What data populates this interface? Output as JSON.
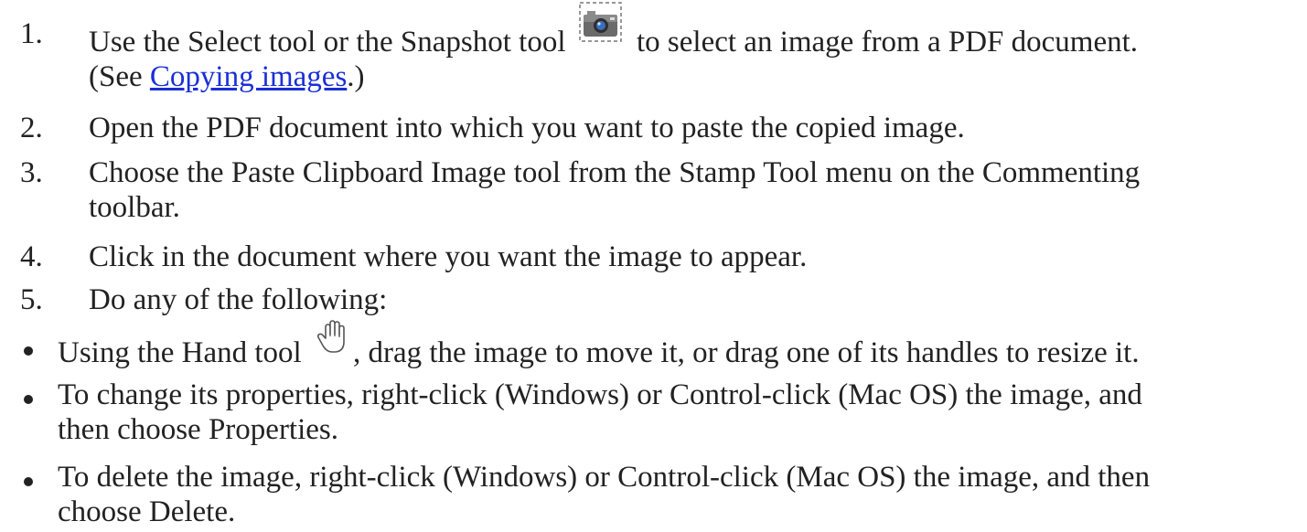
{
  "steps": [
    {
      "number": "1.",
      "text_before_icon": "Use the Select tool or the Snapshot tool",
      "icon": "snapshot-camera-icon",
      "text_after_icon": "to select an image from a PDF document.",
      "see_prefix": "(See ",
      "link_label": "Copying images",
      "see_suffix": ".)"
    },
    {
      "number": "2.",
      "text": "Open the PDF document into which you want to paste the copied image."
    },
    {
      "number": "3.",
      "text_line1": "Choose the Paste Clipboard Image tool from the Stamp Tool menu on the Commenting",
      "text_line2": "toolbar."
    },
    {
      "number": "4.",
      "text": "Click in the document where you want the image to appear."
    },
    {
      "number": "5.",
      "text": "Do any of the following:"
    }
  ],
  "bullets": [
    {
      "text_before_icon": "Using the Hand tool",
      "icon": "hand-icon",
      "text_after_icon": ", drag the image to move it, or drag one of its handles to resize it."
    },
    {
      "text_line1": "To change its properties, right-click (Windows) or Control-click (Mac OS) the image, and",
      "text_line2": "then choose Properties."
    },
    {
      "text_line1": "To delete the image, right-click (Windows) or Control-click (Mac OS) the image, and then",
      "text_line2": "choose Delete."
    }
  ],
  "colors": {
    "text": "#222222",
    "link": "#1a2fd6",
    "background": "#ffffff"
  }
}
